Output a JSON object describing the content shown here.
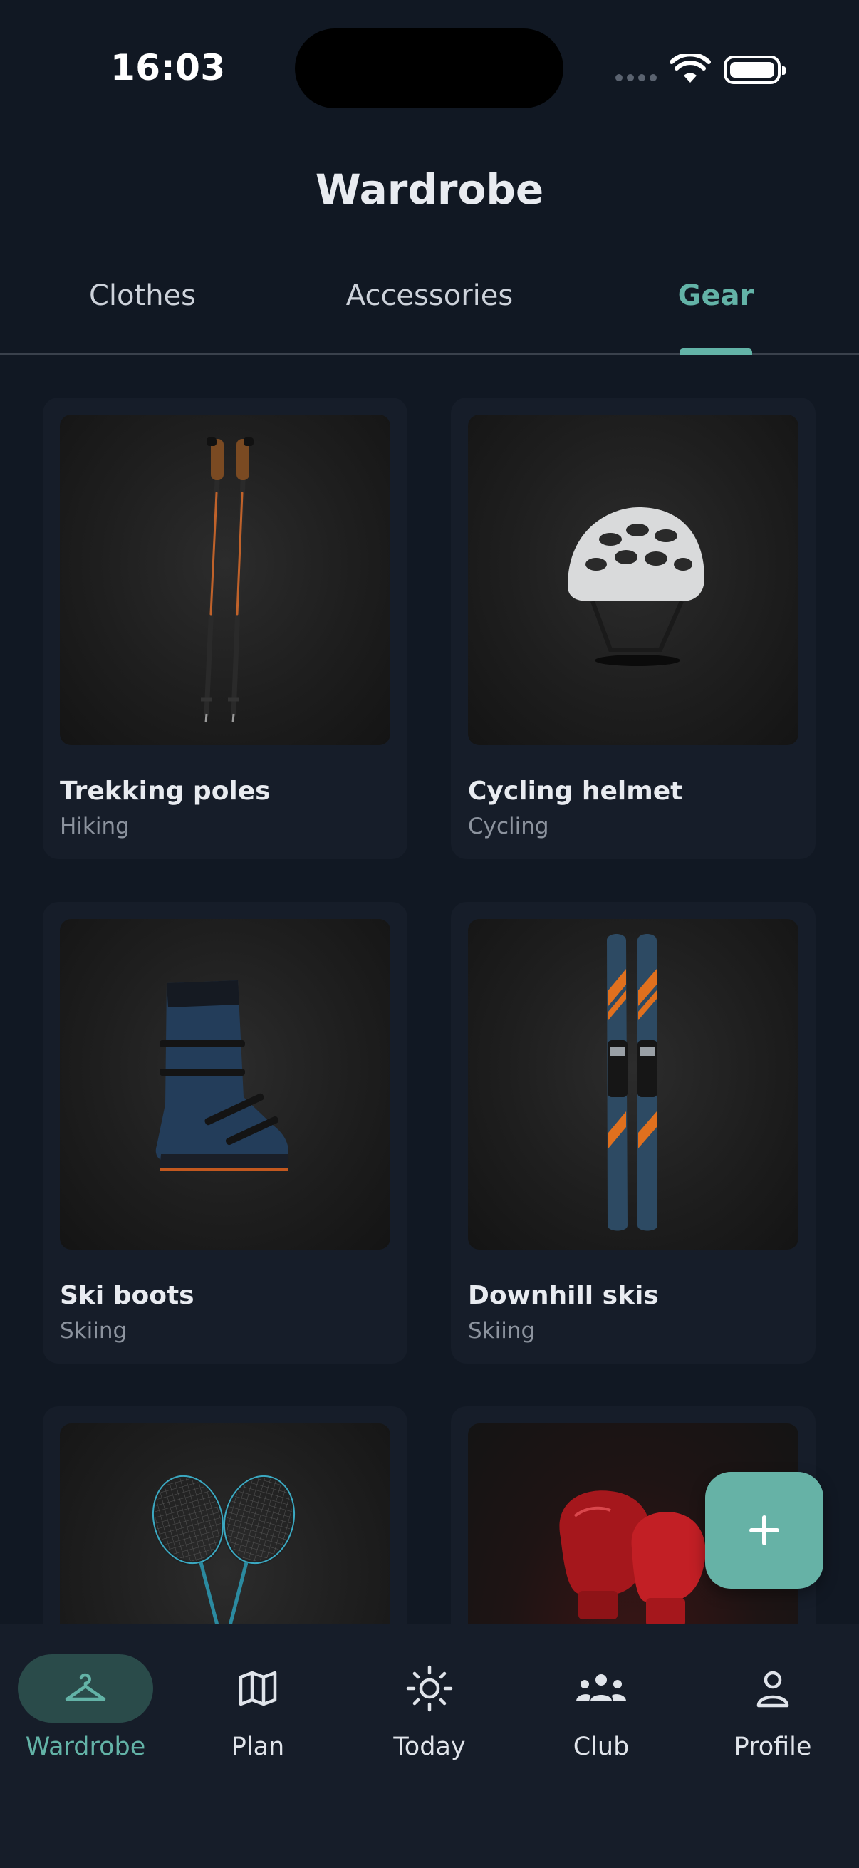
{
  "status_bar": {
    "time": "16:03"
  },
  "header": {
    "title": "Wardrobe"
  },
  "tabs": [
    {
      "label": "Clothes",
      "active": false
    },
    {
      "label": "Accessories",
      "active": false
    },
    {
      "label": "Gear",
      "active": true
    }
  ],
  "items": [
    {
      "name": "Trekking poles",
      "category": "Hiking",
      "image": "trekking-poles-image"
    },
    {
      "name": "Cycling helmet",
      "category": "Cycling",
      "image": "cycling-helmet-image"
    },
    {
      "name": "Ski boots",
      "category": "Skiing",
      "image": "ski-boots-image"
    },
    {
      "name": "Downhill skis",
      "category": "Skiing",
      "image": "downhill-skis-image"
    },
    {
      "name": "",
      "category": "",
      "image": "badminton-rackets-image"
    },
    {
      "name": "",
      "category": "",
      "image": "boxing-gloves-image"
    }
  ],
  "fab": {
    "icon": "plus-icon"
  },
  "bottom_nav": [
    {
      "label": "Wardrobe",
      "icon": "hanger-icon",
      "active": true
    },
    {
      "label": "Plan",
      "icon": "map-icon",
      "active": false
    },
    {
      "label": "Today",
      "icon": "sun-icon",
      "active": false
    },
    {
      "label": "Club",
      "icon": "group-icon",
      "active": false
    },
    {
      "label": "Profile",
      "icon": "person-icon",
      "active": false
    }
  ],
  "colors": {
    "accent": "#63b3a7",
    "background": "#111823",
    "card": "#161d29"
  }
}
